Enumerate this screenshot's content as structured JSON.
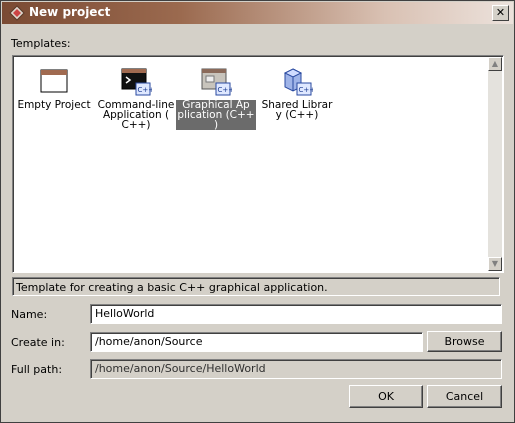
{
  "window": {
    "title": "New project"
  },
  "templates": {
    "label": "Templates:",
    "items": [
      {
        "line1": "Empty Project",
        "line2": "",
        "line3": "",
        "icon": "empty-project-icon"
      },
      {
        "line1": "Command-line",
        "line2": "Application (",
        "line3": "C++)",
        "icon": "console-app-icon"
      },
      {
        "line1": "Graphical Ap",
        "line2": "plication (C++",
        "line3": ")",
        "icon": "graphical-app-icon",
        "selected": true
      },
      {
        "line1": "Shared Librar",
        "line2": "y (C++)",
        "line3": "",
        "icon": "shared-library-icon"
      }
    ],
    "description": "Template for creating a basic C++ graphical application."
  },
  "form": {
    "name_label": "Name:",
    "name_value": "HelloWorld",
    "create_in_label": "Create in:",
    "create_in_value": "/home/anon/Source",
    "browse_label": "Browse",
    "full_path_label": "Full path:",
    "full_path_value": "/home/anon/Source/HelloWorld"
  },
  "buttons": {
    "ok": "OK",
    "cancel": "Cancel"
  },
  "colors": {
    "title_start": "#7a4a33",
    "selection": "#6b6b6b",
    "background": "#d4d0c8"
  }
}
